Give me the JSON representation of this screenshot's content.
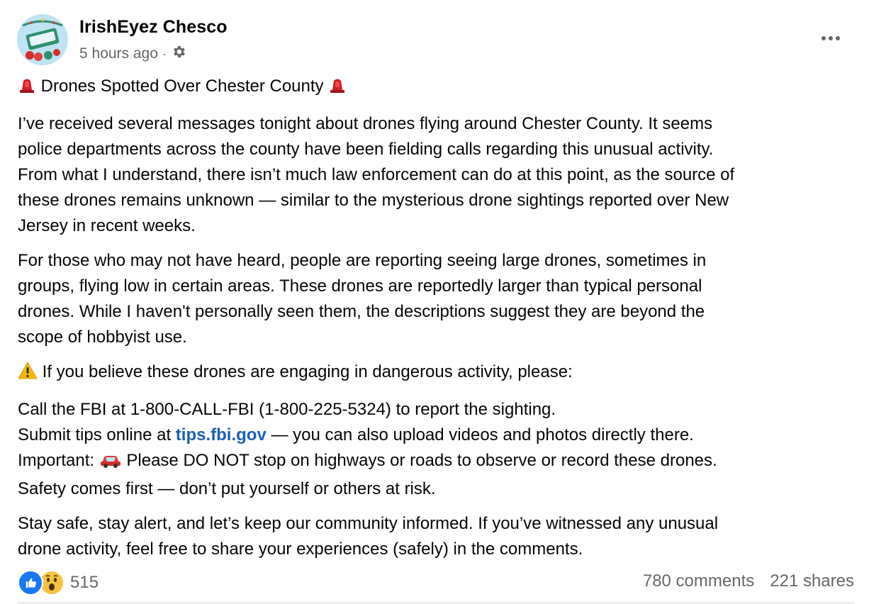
{
  "post": {
    "author": "IrishEyez Chesco",
    "time": "5 hours ago",
    "separator": "·",
    "title": "Drones Spotted Over Chester County",
    "paragraphs": [
      [
        "I’ve received several messages tonight about drones flying around Chester County. It seems",
        "police departments across the county have been fielding calls regarding this unusual activity.",
        "From what I understand, there isn’t much law enforcement can do at this point, as the source of",
        "these drones remains unknown — similar to the mysterious drone sightings reported over New",
        "Jersey in recent weeks."
      ],
      [
        "For those who may not have heard, people are reporting seeing large drones, sometimes in",
        "groups, flying low in certain areas. These drones are reportedly larger than typical personal",
        "drones. While I haven't personally seen them, the descriptions suggest they are beyond the",
        "scope of hobbyist use."
      ]
    ],
    "warning_line": "If you believe these drones are engaging in dangerous activity, please:",
    "instructions": {
      "line1": "Call the FBI at 1-800-CALL-FBI (1-800-225-5324) to report the sighting.",
      "line2_prefix": "Submit tips online at ",
      "line2_link": "tips.fbi.gov",
      "line2_suffix": " — you can also upload videos and photos directly there.",
      "line3_prefix": "Important: ",
      "line3_suffix": " Please DO NOT stop on highways or roads to observe or record these drones.",
      "line4": "Safety comes first — don’t put yourself or others at risk."
    },
    "closing": [
      "Stay safe, stay alert, and let’s keep our community informed. If you’ve witnessed any unusual",
      "drone activity, feel free to share your experiences (safely) in the comments."
    ]
  },
  "footer": {
    "reaction_count": "515",
    "comments": "780 comments",
    "shares": "221 shares"
  },
  "icons": {
    "settings": "gear-icon",
    "more": "more-options-icon",
    "siren": "police-light-icon",
    "warning": "warning-icon",
    "car": "car-icon",
    "like": "like-reaction-icon",
    "wow": "wow-reaction-icon"
  },
  "colors": {
    "link": "#1b5fb8",
    "secondary_text": "#65676b",
    "like_blue": "#1877f2",
    "wow_yellow": "#f7c53d"
  }
}
